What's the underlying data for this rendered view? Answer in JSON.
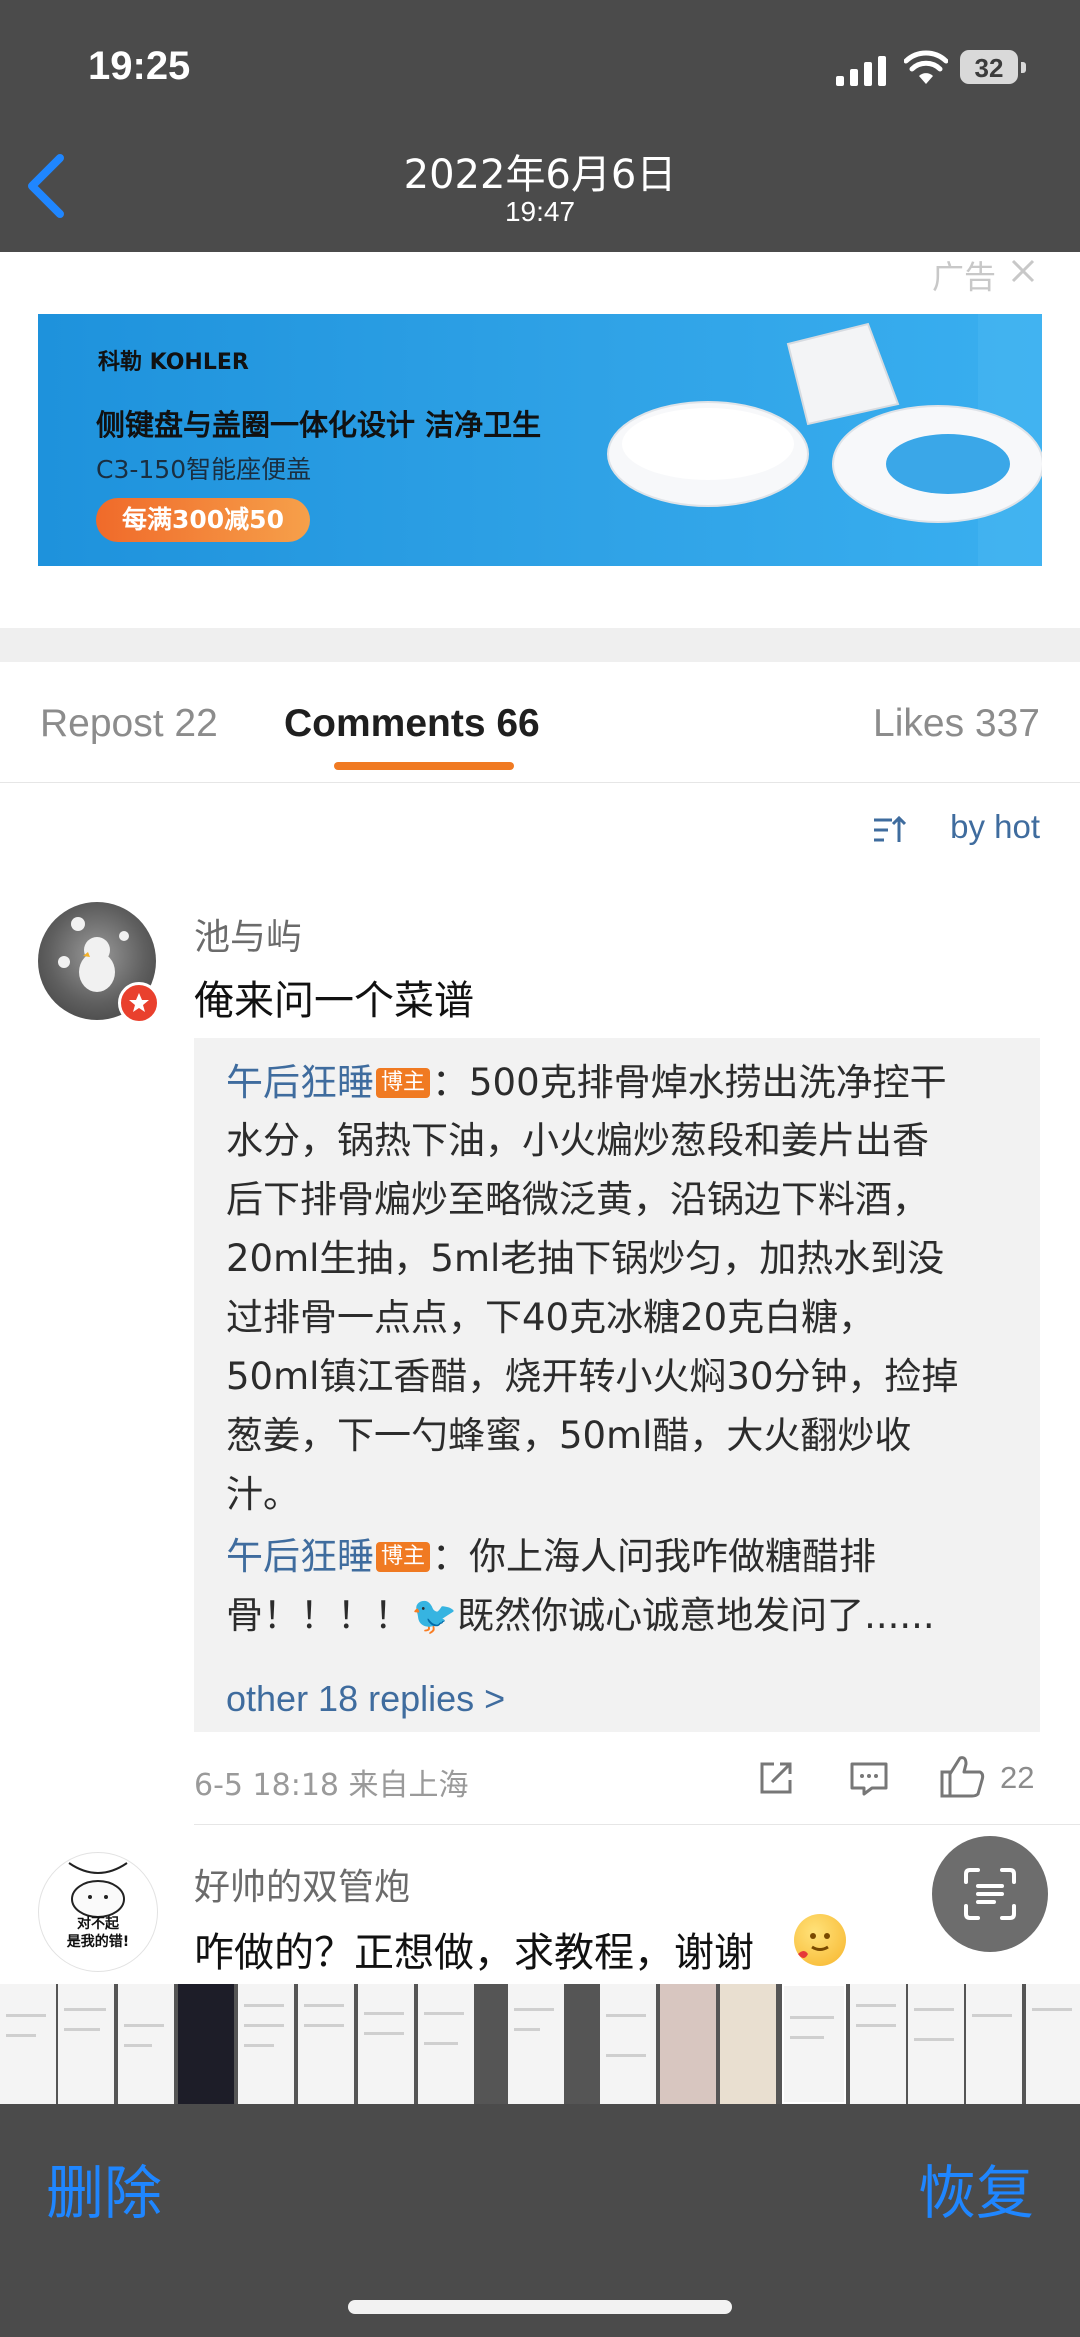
{
  "status": {
    "time": "19:25",
    "battery": "32"
  },
  "nav": {
    "date": "2022年6月6日",
    "time": "19:47"
  },
  "ad": {
    "tag": "广告",
    "brand": "科勒 KOHLER",
    "headline": "侧键盘与盖圈一体化设计 洁净卫生",
    "subline": "C3-150智能座便盖",
    "promo": "每满300减50"
  },
  "tabs": {
    "repost": "Repost 22",
    "comments": "Comments 66",
    "likes": "Likes 337"
  },
  "sort": {
    "label": "by hot"
  },
  "comments": [
    {
      "user": "池与屿",
      "text": "俺来问一个菜谱",
      "replies": [
        {
          "user": "午后狂睡",
          "badge": "博主",
          "lines": [
            "：500克排骨焯水捞出洗净控干",
            "水分，锅热下油，小火煸炒葱段和姜片出香",
            "后下排骨煸炒至略微泛黄，沿锅边下料酒，",
            "20ml生抽，5ml老抽下锅炒匀，加热水到没",
            "过排骨一点点，下40克冰糖20克白糖，",
            "50ml镇江香醋，烧开转小火焖30分钟，捡掉",
            "葱姜，下一勺蜂蜜，50ml醋，大火翻炒收",
            "汁。"
          ]
        },
        {
          "user": "午后狂睡",
          "badge": "博主",
          "lines": [
            "：你上海人问我咋做糖醋排",
            "骨！！！！🐦既然你诚心诚意地发问了......"
          ]
        }
      ],
      "more_replies": "other 18 replies >",
      "meta": "6-5 18:18  来自上海",
      "likes": "22"
    },
    {
      "user": "好帅的双管炮",
      "text": "咋做的？正想做，求教程，谢谢",
      "avatar_text": "对不起\n是我的错!"
    }
  ],
  "bottom": {
    "delete": "删除",
    "restore": "恢复"
  },
  "colors": {
    "accent": "#f07a22",
    "link": "#3f6c9e",
    "ios_blue": "#1f86ff"
  }
}
